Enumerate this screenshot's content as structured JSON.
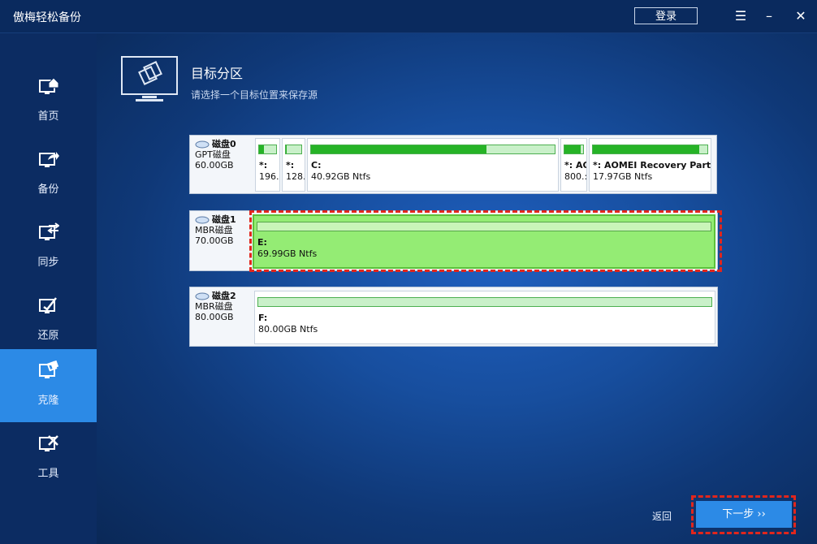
{
  "app": {
    "title": "傲梅轻松备份",
    "login_label": "登录"
  },
  "sidebar": {
    "items": [
      {
        "label": "首页",
        "icon": "home-icon"
      },
      {
        "label": "备份",
        "icon": "backup-icon"
      },
      {
        "label": "同步",
        "icon": "sync-icon"
      },
      {
        "label": "还原",
        "icon": "restore-icon"
      },
      {
        "label": "克隆",
        "icon": "clone-icon",
        "active": true
      },
      {
        "label": "工具",
        "icon": "tools-icon"
      }
    ]
  },
  "main": {
    "title": "目标分区",
    "subtitle": "请选择一个目标位置来保存源"
  },
  "disks": [
    {
      "name": "磁盘0",
      "type": "GPT磁盘",
      "size": "60.00GB",
      "partitions": [
        {
          "label": "*:",
          "size": "196.",
          "used": 0.3
        },
        {
          "label": "*:",
          "size": "128.",
          "used": 0.05
        },
        {
          "label": "C:",
          "size": "40.92GB Ntfs",
          "used": 0.72
        },
        {
          "label": "*: AO",
          "size": "800.:",
          "used": 0.85
        },
        {
          "label": "*: AOMEI Recovery Partit",
          "size": "17.97GB Ntfs",
          "used": 0.93
        }
      ]
    },
    {
      "name": "磁盘1",
      "type": "MBR磁盘",
      "size": "70.00GB",
      "partitions": [
        {
          "label": "E:",
          "size": "69.99GB Ntfs",
          "used": 0.0,
          "selected": true
        }
      ]
    },
    {
      "name": "磁盘2",
      "type": "MBR磁盘",
      "size": "80.00GB",
      "partitions": [
        {
          "label": "F:",
          "size": "80.00GB Ntfs",
          "used": 0.0
        }
      ]
    }
  ],
  "footer": {
    "back_label": "返回",
    "next_label": "下一步 ››"
  },
  "colors": {
    "accent": "#2c8ae6",
    "selected_partition": "#94ec74",
    "highlight": "#e1261c"
  }
}
